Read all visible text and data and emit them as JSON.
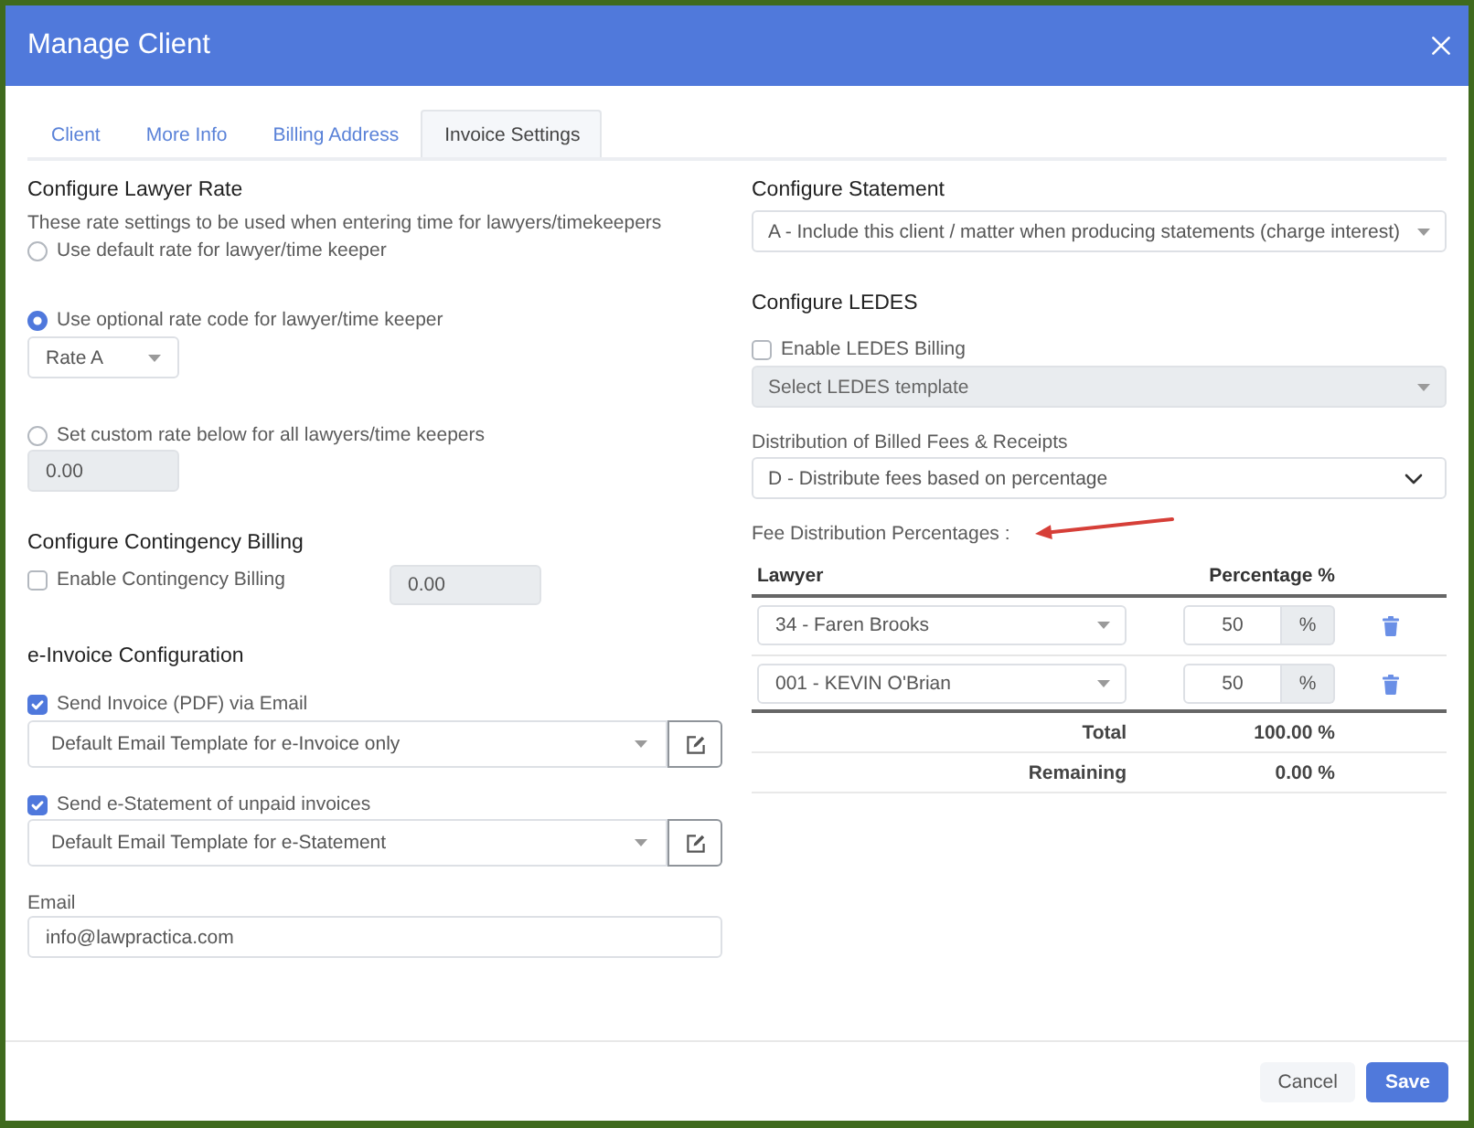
{
  "window": {
    "title": "Manage Client"
  },
  "tabs": [
    {
      "label": "Client",
      "selected": false
    },
    {
      "label": "More Info",
      "selected": false
    },
    {
      "label": "Billing Address",
      "selected": false
    },
    {
      "label": "Invoice Settings",
      "selected": true
    }
  ],
  "lawyer_rate": {
    "heading": "Configure Lawyer Rate",
    "description": "These rate settings to be used when entering time for lawyers/timekeepers",
    "options": [
      {
        "kind": "plain",
        "label": "Use default rate for lawyer/time keeper",
        "selected": false
      },
      {
        "kind": "select",
        "label": "Use optional rate code for lawyer/time keeper",
        "selected": true,
        "value": "Rate A",
        "disabled": false
      },
      {
        "kind": "input",
        "label": "Set custom rate below for all lawyers/time keepers",
        "selected": false,
        "value": "0.00",
        "disabled": true
      }
    ]
  },
  "contingency": {
    "heading": "Configure Contingency Billing",
    "checkbox": {
      "label": "Enable Contingency Billing",
      "checked": false
    },
    "input": {
      "value": "0.00",
      "disabled": true
    }
  },
  "e_invoice": {
    "heading": "e-Invoice Configuration",
    "items": [
      {
        "label": "Send Invoice (PDF) via Email",
        "checked": true,
        "template": "Default Email Template for e-Invoice only"
      },
      {
        "label": "Send e-Statement of unpaid invoices",
        "checked": true,
        "template": "Default Email Template for e-Statement"
      }
    ]
  },
  "email": {
    "label": "Email",
    "value": "info@lawpractica.com"
  },
  "statement": {
    "heading": "Configure Statement",
    "value": "A - Include this client / matter when producing statements (charge interest)"
  },
  "ledes": {
    "heading": "Configure LEDES",
    "checkbox": {
      "label": "Enable LEDES Billing",
      "checked": false
    },
    "template": {
      "placeholder": "Select LEDES template",
      "disabled": true
    }
  },
  "distribution": {
    "label": "Distribution of Billed Fees & Receipts",
    "value": "D - Distribute fees based on percentage"
  },
  "fee_distribution": {
    "label": "Fee Distribution Percentages :",
    "columns": [
      "Lawyer",
      "Percentage %"
    ],
    "rows": [
      {
        "lawyer": "34 - Faren Brooks",
        "percentage": "50",
        "unit": "%"
      },
      {
        "lawyer": "001 - KEVIN O'Brian",
        "percentage": "50",
        "unit": "%"
      }
    ],
    "summary": [
      {
        "label": "Total",
        "value": "100.00 %"
      },
      {
        "label": "Remaining",
        "value": "0.00 %"
      }
    ]
  },
  "footer": {
    "buttons": [
      {
        "label": "Cancel",
        "kind": "secondary"
      },
      {
        "label": "Save",
        "kind": "primary"
      }
    ]
  }
}
